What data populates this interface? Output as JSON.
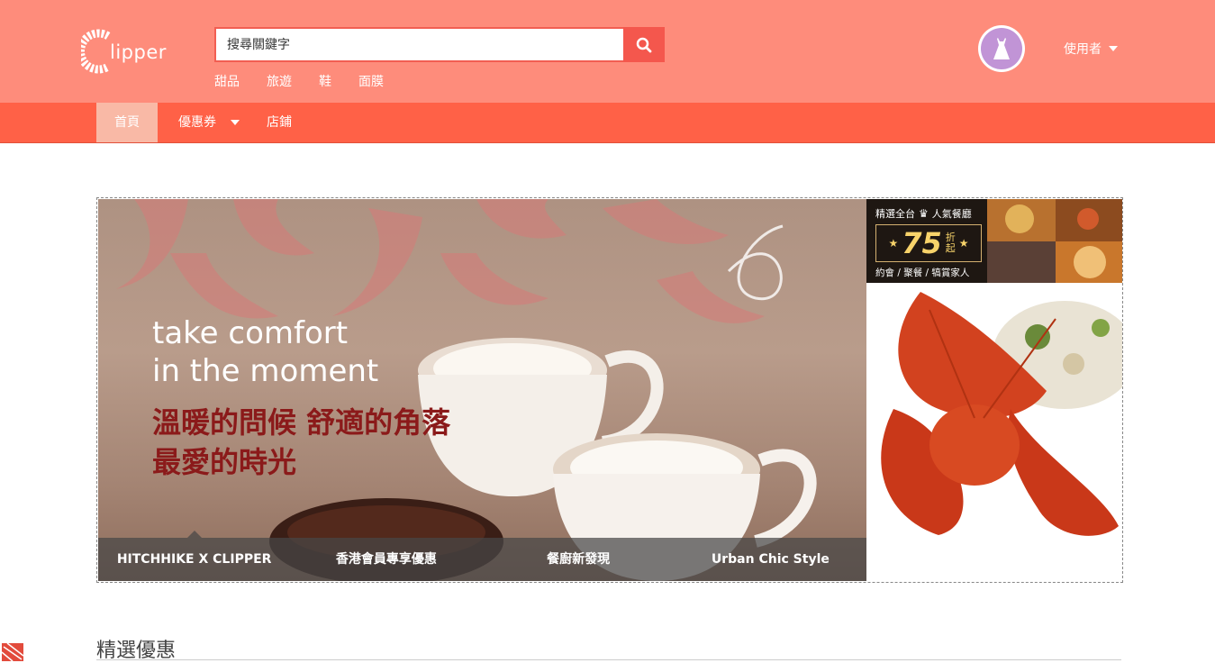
{
  "header": {
    "logo_text": "lipper",
    "search": {
      "placeholder": "搜尋關鍵字",
      "value": ""
    },
    "hot_keywords": [
      "甜品",
      "旅遊",
      "鞋",
      "面膜"
    ],
    "user_label": "使用者"
  },
  "nav": {
    "home": "首頁",
    "coupons": "優惠券",
    "shops": "店鋪"
  },
  "hero": {
    "slide_title_en_1": "take comfort",
    "slide_title_en_2": "in the moment",
    "slide_title_zh_1": "溫暖的問候 舒適的角落",
    "slide_title_zh_2": "最愛的時光",
    "tabs": [
      "HITCHHIKE X CLIPPER",
      "香港會員專享優惠",
      "餐廚新發現",
      "Urban Chic Style"
    ],
    "side_top": {
      "heading": "精選全台",
      "heading2": "人氣餐廳",
      "discount": "75",
      "discount_unit_1": "折",
      "discount_unit_2": "起",
      "tagline": "約會 / 聚餐 / 犒賞家人"
    }
  },
  "section": {
    "title": "精選優惠"
  },
  "colors": {
    "header_bg": "#fe8c7b",
    "nav_bg": "#ff6147",
    "search_accent": "#f4574d"
  }
}
